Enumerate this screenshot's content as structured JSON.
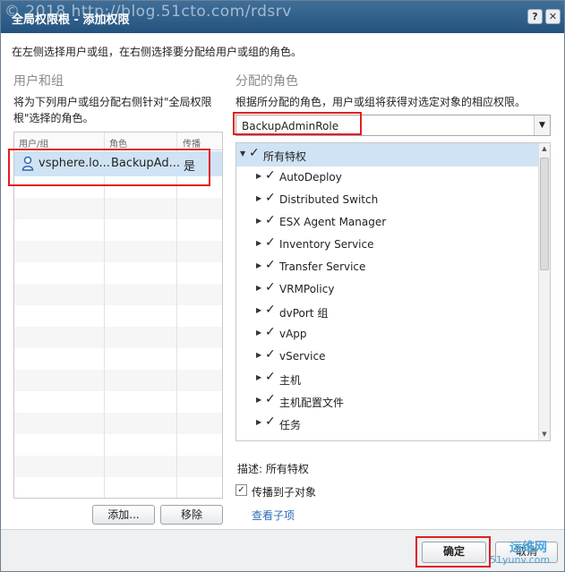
{
  "titlebar": {
    "watermark": "© 2018 http://blog.51cto.com/rdsrv",
    "title": "全局权限根 - 添加权限",
    "help_icon": "help-icon",
    "close_icon": "close-icon"
  },
  "intro": "在左侧选择用户或组，在右侧选择要分配给用户或组的角色。",
  "left": {
    "section_title": "用户和组",
    "description": "将为下列用户或组分配右侧针对\"全局权限根\"选择的角色。",
    "columns": [
      "用户/组",
      "角色",
      "传播"
    ],
    "rows": [
      {
        "user": "vsphere.lo...",
        "role": "BackupAd...",
        "propagate": "是",
        "icon": "user-icon"
      }
    ],
    "add_button": "添加...",
    "remove_button": "移除"
  },
  "right": {
    "section_title": "分配的角色",
    "description": "根据所分配的角色，用户或组将获得对选定对象的相应权限。",
    "role_select": "BackupAdminRole",
    "tree_root": "所有特权",
    "tree_items": [
      "AutoDeploy",
      "Distributed Switch",
      "ESX Agent Manager",
      "Inventory Service",
      "Transfer Service",
      "VRMPolicy",
      "dvPort 组",
      "vApp",
      "vService",
      "主机",
      "主机配置文件",
      "任务"
    ],
    "description_label": "描述:",
    "description_value": "所有特权",
    "propagate_label": "传播到子对象",
    "propagate_checked": true,
    "view_children_link": "查看子项"
  },
  "footer": {
    "ok_button": "确定",
    "cancel_button": "取消",
    "watermark_text": "运维网",
    "watermark_url": "51yunv.com"
  },
  "colors": {
    "titlebar": "#2f6290",
    "selection": "#cfe3f5",
    "highlight_box": "#e02020",
    "link": "#2a6cb5"
  }
}
